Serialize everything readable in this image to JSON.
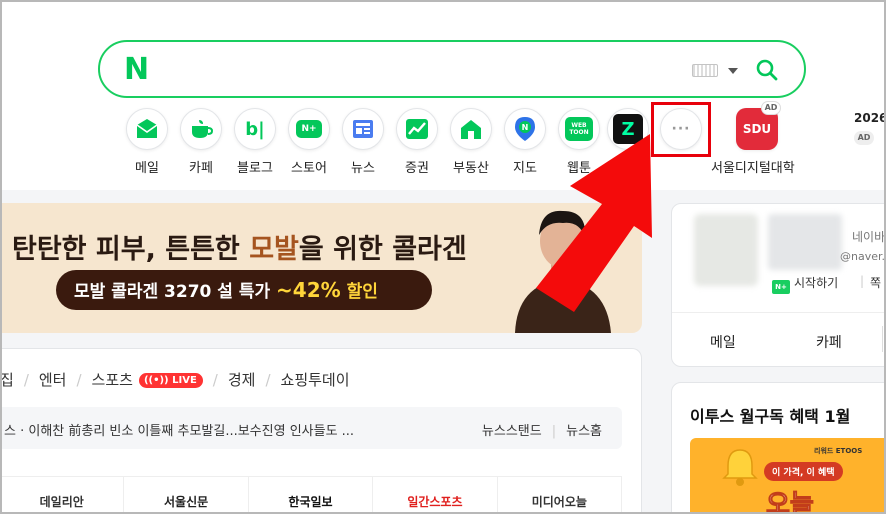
{
  "search": {
    "logo": "N",
    "value": "",
    "placeholder": ""
  },
  "shortcuts": [
    {
      "label": "메일",
      "icon": "mail-icon"
    },
    {
      "label": "카페",
      "icon": "cafe-icon"
    },
    {
      "label": "블로그",
      "icon": "blog-icon"
    },
    {
      "label": "스토어",
      "icon": "store-icon"
    },
    {
      "label": "뉴스",
      "icon": "news-icon"
    },
    {
      "label": "증권",
      "icon": "stock-icon"
    },
    {
      "label": "부동산",
      "icon": "realestate-icon"
    },
    {
      "label": "지도",
      "icon": "map-icon"
    },
    {
      "label": "웹툰",
      "icon": "webtoon-icon"
    },
    {
      "label": "치지직",
      "icon": "chzzk-icon"
    },
    {
      "label": "",
      "icon": "more-icon"
    }
  ],
  "icon_text": {
    "blog": "b|",
    "store": "N+",
    "webtoon": "WEB TOON",
    "chzzk": "Z",
    "more": "···",
    "sdu": "SDU",
    "mail_n": "N"
  },
  "ad_shortcut": {
    "label": "서울디지털대학",
    "badge": "AD"
  },
  "right_ad": {
    "text": "2026",
    "badge": "AD"
  },
  "banner": {
    "headline_pre": "탄탄한 피부, 튼튼한 ",
    "headline_highlight": "모발",
    "headline_post": "을 위한 콜라겐",
    "promo_text": "모발 콜라겐 3270 설 특가 ",
    "promo_percent": "~42%",
    "promo_suffix": " 할인"
  },
  "news_tabs": [
    "집",
    "엔터",
    "스포츠",
    "경제",
    "쇼핑투데이"
  ],
  "live_badge": "LIVE",
  "ticker": {
    "headline": "스 · 이해찬 前총리 빈소 이틀째 추모발길...보수진영 인사들도 ...",
    "link1": "뉴스스탠드",
    "link2": "뉴스홈"
  },
  "newspapers": [
    "데일리안",
    "서울신문",
    "한국일보",
    "일간스포츠",
    "미디어오늘"
  ],
  "login_panel": {
    "line1": "네이바",
    "line2": "@naver.co",
    "start": "시작하기",
    "start_mini": "N+",
    "extra": "쪽",
    "mail": "메일",
    "cafe": "카페"
  },
  "ad_box": {
    "title": "이투스 월구독 혜택 1월 ",
    "etoos": "리워드 ETOOS",
    "tagline": "이 가격, 이 혜택",
    "big": "오늘"
  },
  "colors": {
    "naver_green": "#03c75a",
    "highlight_red": "#e8000b",
    "banner_bg": "#f6e6cf",
    "live_red": "#ff3333"
  }
}
